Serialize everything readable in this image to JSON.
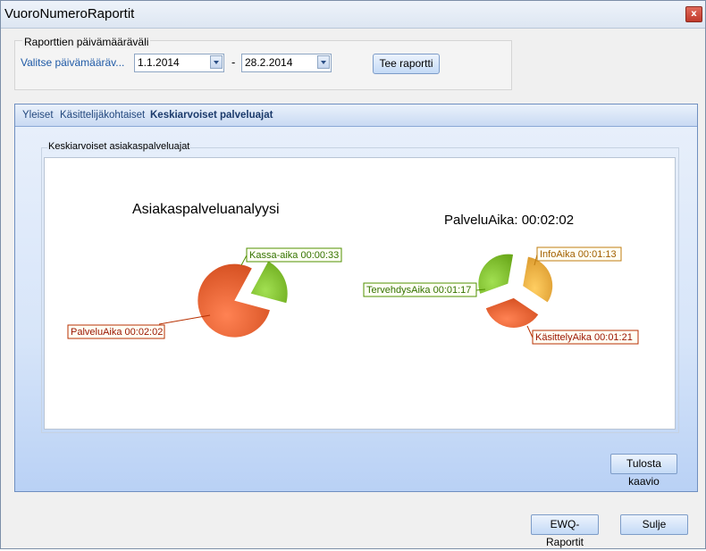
{
  "window": {
    "title": "VuoroNumeroRaportit",
    "close": "x"
  },
  "date_range": {
    "group_title": "Raporttien päivämääräväli",
    "label": "Valitse päivämääräv...",
    "start": "1.1.2014",
    "separator": "-",
    "end": "28.2.2014",
    "report_button": "Tee raportti"
  },
  "tabs": [
    {
      "label": "Yleiset",
      "active": false
    },
    {
      "label": "Käsittelijäkohtaiset",
      "active": false
    },
    {
      "label": "Keskiarvoiset palveluajat",
      "active": true
    }
  ],
  "chart_group_title": "Keskiarvoiset asiakaspalveluajat",
  "chart_data": [
    {
      "type": "pie",
      "title": "Asiakaspalveluanalyysi",
      "slices": [
        {
          "label": "PalveluAika 00:02:02",
          "value": 122,
          "color": "#e05a2b"
        },
        {
          "label": "Kassa-aika 00:00:33",
          "value": 33,
          "color": "#7ab82a"
        }
      ]
    },
    {
      "type": "pie",
      "title": "PalveluAika: 00:02:02",
      "slices": [
        {
          "label": "InfoAika 00:01:13",
          "value": 73,
          "color": "#e8a63a"
        },
        {
          "label": "KäsittelyAika 00:01:21",
          "value": 81,
          "color": "#e05a2b"
        },
        {
          "label": "TervehdysAika 00:01:17",
          "value": 77,
          "color": "#7ab82a"
        }
      ]
    }
  ],
  "buttons": {
    "print_chart": "Tulosta kaavio",
    "ewq_report": "EWQ-Raportit",
    "close": "Sulje"
  }
}
